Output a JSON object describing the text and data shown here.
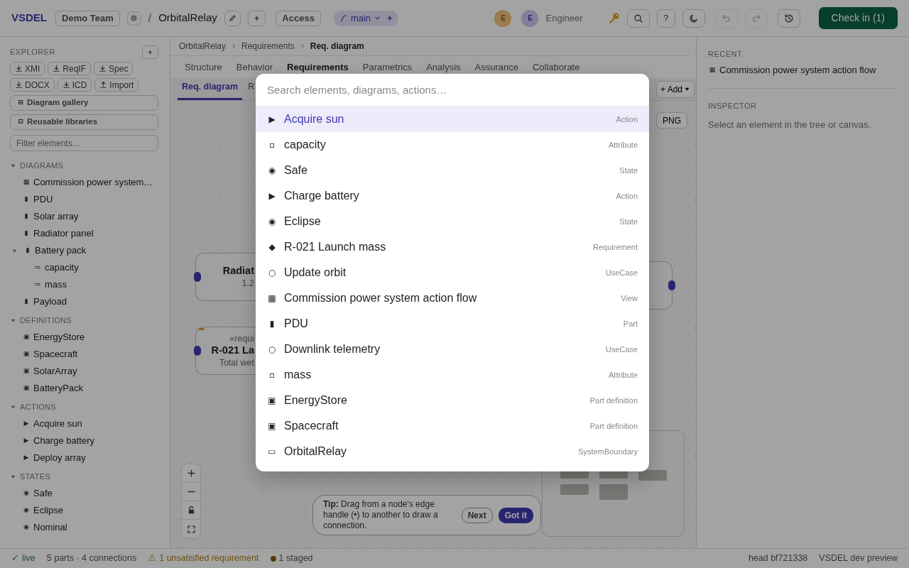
{
  "topbar": {
    "logo": "VSDEL",
    "team": "Demo Team",
    "separator": "/",
    "project": "OrbitalRelay",
    "add": "+",
    "access": "Access",
    "branch": {
      "name": "main",
      "add": "+"
    },
    "users": [
      {
        "initial": "E"
      },
      {
        "initial": "E"
      }
    ],
    "user_name": "Engineer",
    "tools": [
      {
        "kind": "search",
        "disabled": false
      },
      {
        "kind": "help",
        "label": "?",
        "disabled": false
      },
      {
        "kind": "theme",
        "disabled": false
      },
      {
        "kind": "undo",
        "disabled": true
      },
      {
        "kind": "redo",
        "disabled": true
      },
      {
        "kind": "history",
        "disabled": false
      }
    ],
    "check_in": "Check in (1)"
  },
  "explorer": {
    "title": "EXPLORER",
    "add": "+",
    "exports": [
      {
        "kind": "download",
        "label": "XMI"
      },
      {
        "kind": "download",
        "label": "ReqIF"
      },
      {
        "kind": "download",
        "label": "Spec"
      },
      {
        "kind": "download",
        "label": "DOCX"
      },
      {
        "kind": "download",
        "label": "ICD"
      },
      {
        "kind": "upload",
        "label": "Import"
      }
    ],
    "links": [
      {
        "icon": "⊞",
        "label": "Diagram gallery"
      },
      {
        "icon": "⊟",
        "label": "Reusable libraries"
      }
    ],
    "filter_placeholder": "Filter elements…",
    "sections": [
      {
        "label": "DIAGRAMS",
        "expanded": true,
        "items": [
          {
            "icon": "▦",
            "label": "Commission power system…"
          },
          {
            "icon": "▮",
            "label": "PDU"
          },
          {
            "icon": "▮",
            "label": "Solar array"
          },
          {
            "icon": "▮",
            "label": "Radiator panel"
          },
          {
            "icon": "▮",
            "label": "Battery pack",
            "expanded": true,
            "children": [
              {
                "icon": "≔",
                "label": "capacity"
              },
              {
                "icon": "≔",
                "label": "mass"
              }
            ]
          },
          {
            "icon": "▮",
            "label": "Payload"
          }
        ]
      },
      {
        "label": "DEFINITIONS",
        "expanded": true,
        "items": [
          {
            "icon": "▣",
            "label": "EnergyStore"
          },
          {
            "icon": "▣",
            "label": "Spacecraft"
          },
          {
            "icon": "▣",
            "label": "SolarArray"
          },
          {
            "icon": "▣",
            "label": "BatteryPack"
          }
        ]
      },
      {
        "label": "ACTIONS",
        "expanded": true,
        "items": [
          {
            "icon": "▶",
            "label": "Acquire sun"
          },
          {
            "icon": "▶",
            "label": "Charge battery"
          },
          {
            "icon": "▶",
            "label": "Deploy array"
          }
        ]
      },
      {
        "label": "STATES",
        "expanded": true,
        "items": [
          {
            "icon": "◉",
            "label": "Safe"
          },
          {
            "icon": "◉",
            "label": "Eclipse"
          },
          {
            "icon": "◉",
            "label": "Nominal"
          }
        ]
      }
    ]
  },
  "workspace": {
    "breadcrumb": [
      "OrbitalRelay",
      "Requirements",
      "Req. diagram"
    ],
    "tabs": [
      {
        "label": "Structure",
        "selected": false
      },
      {
        "label": "Behavior",
        "selected": false
      },
      {
        "label": "Requirements",
        "selected": true
      },
      {
        "label": "Parametrics",
        "selected": false
      },
      {
        "label": "Analysis",
        "selected": false
      },
      {
        "label": "Assurance",
        "selected": false
      },
      {
        "label": "Collaborate",
        "selected": false
      }
    ],
    "subtabs": [
      {
        "label": "Req. diagram",
        "selected": true
      },
      {
        "label": "R",
        "selected": false
      }
    ],
    "add_menu": "+ Add",
    "export_png": "PNG",
    "nodes": [
      {
        "kind": "block",
        "title": "Radiat",
        "subtitle": "1.2"
      },
      {
        "kind": "requirement",
        "stereotype": "«requi",
        "title": "R-021 La",
        "subtitle": "Total wet"
      },
      {
        "kind": "block"
      }
    ],
    "tip": {
      "text": "**Tip:** Drag from a node's edge handle (•) to another to draw a connection.",
      "next": "Next",
      "dismiss": "Got it"
    }
  },
  "side_panel": {
    "recent_title": "RECENT",
    "recent": [
      {
        "icon": "▦",
        "label": "Commission power system action flow"
      }
    ],
    "inspector_title": "INSPECTOR",
    "inspector_hint": "Select an element in the tree or canvas."
  },
  "status_bar": {
    "live_icon": "✓",
    "live": "live",
    "summary": "5 parts · 4 connections",
    "warning_icon": "⚠",
    "warning": "1 unsatisfied requirement",
    "staged": "1 staged",
    "head": "head bf721338",
    "env": "VSDEL dev preview"
  },
  "command_palette": {
    "placeholder": "Search elements, diagrams, actions…",
    "results": [
      {
        "icon": "▶",
        "label": "Acquire sun",
        "type": "Action",
        "selected": true
      },
      {
        "icon": "▫",
        "label": "capacity",
        "type": "Attribute",
        "selected": false
      },
      {
        "icon": "◉",
        "label": "Safe",
        "type": "State",
        "selected": false
      },
      {
        "icon": "▶",
        "label": "Charge battery",
        "type": "Action",
        "selected": false
      },
      {
        "icon": "◉",
        "label": "Eclipse",
        "type": "State",
        "selected": false
      },
      {
        "icon": "◆",
        "label": "R-021 Launch mass",
        "type": "Requirement",
        "selected": false
      },
      {
        "icon": "○",
        "label": "Update orbit",
        "type": "UseCase",
        "selected": false
      },
      {
        "icon": "▦",
        "label": "Commission power system action flow",
        "type": "View",
        "selected": false
      },
      {
        "icon": "▮",
        "label": "PDU",
        "type": "Part",
        "selected": false
      },
      {
        "icon": "○",
        "label": "Downlink telemetry",
        "type": "UseCase",
        "selected": false
      },
      {
        "icon": "▫",
        "label": "mass",
        "type": "Attribute",
        "selected": false
      },
      {
        "icon": "▣",
        "label": "EnergyStore",
        "type": "Part definition",
        "selected": false
      },
      {
        "icon": "▣",
        "label": "Spacecraft",
        "type": "Part definition",
        "selected": false
      },
      {
        "icon": "▭",
        "label": "OrbitalRelay",
        "type": "SystemBoundary",
        "selected": false
      }
    ]
  }
}
